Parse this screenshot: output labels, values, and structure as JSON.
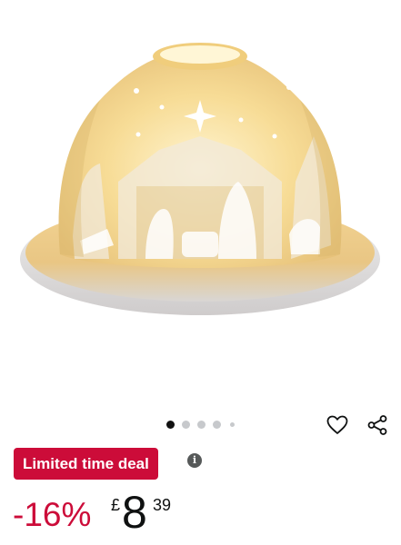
{
  "product": {
    "image_alt": "White porcelain dome tealight holder with illuminated nativity scene"
  },
  "carousel": {
    "dot_count": 5,
    "active_index": 0
  },
  "deal": {
    "badge_label": "Limited time deal",
    "info_glyph": "i"
  },
  "price": {
    "discount": "-16%",
    "currency": "£",
    "whole": "8",
    "fraction": "39"
  },
  "icons": {
    "wishlist": "heart-outline-icon",
    "share": "share-icon",
    "info": "info-icon"
  },
  "colors": {
    "deal_red": "#cc0c39",
    "active_dot": "#111111",
    "inactive_dot": "#c7c9cc",
    "glow": "#f6d98f"
  }
}
